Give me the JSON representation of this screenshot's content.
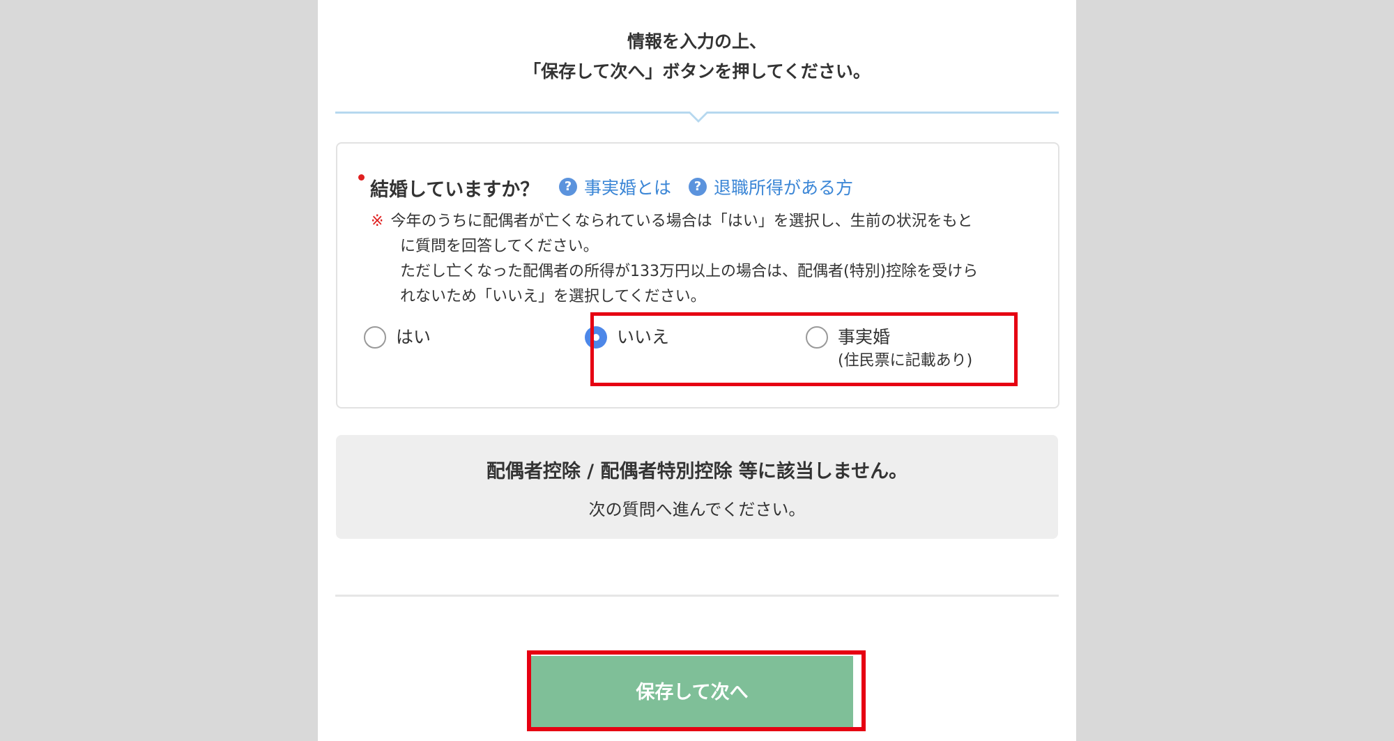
{
  "instruction": {
    "line1": "情報を入力の上、",
    "line2": "「保存して次へ」ボタンを押してください。"
  },
  "question": {
    "title": "結婚していますか？",
    "help_links": [
      {
        "label": "事実婚とは",
        "icon": "question-circle-icon"
      },
      {
        "label": "退職所得がある方",
        "icon": "question-circle-icon"
      }
    ],
    "note_mark": "※",
    "note_lines": [
      "今年のうちに配偶者が亡くなられている場合は「はい」を選択し、生前の状況をもと",
      "に質問を回答してください。",
      "ただし亡くなった配偶者の所得が133万円以上の場合は、配偶者(特別)控除を受けら",
      "れないため「いいえ」を選択してください。"
    ],
    "options": [
      {
        "label": "はい",
        "selected": false
      },
      {
        "label": "いいえ",
        "selected": true
      },
      {
        "label": "事実婚",
        "sub": "(住民票に記載あり)",
        "selected": false
      }
    ]
  },
  "result": {
    "title": "配偶者控除 / 配偶者特別控除 等に該当しません。",
    "subtitle": "次の質問へ進んでください。"
  },
  "save_button": {
    "label": "保存して次へ"
  },
  "colors": {
    "background": "#d9d9d9",
    "panel": "#ffffff",
    "accent_blue": "#4d87e8",
    "link_blue": "#3b86d6",
    "button_green": "#7fbf98",
    "highlight_red": "#e60012",
    "required_red": "#e02020"
  }
}
